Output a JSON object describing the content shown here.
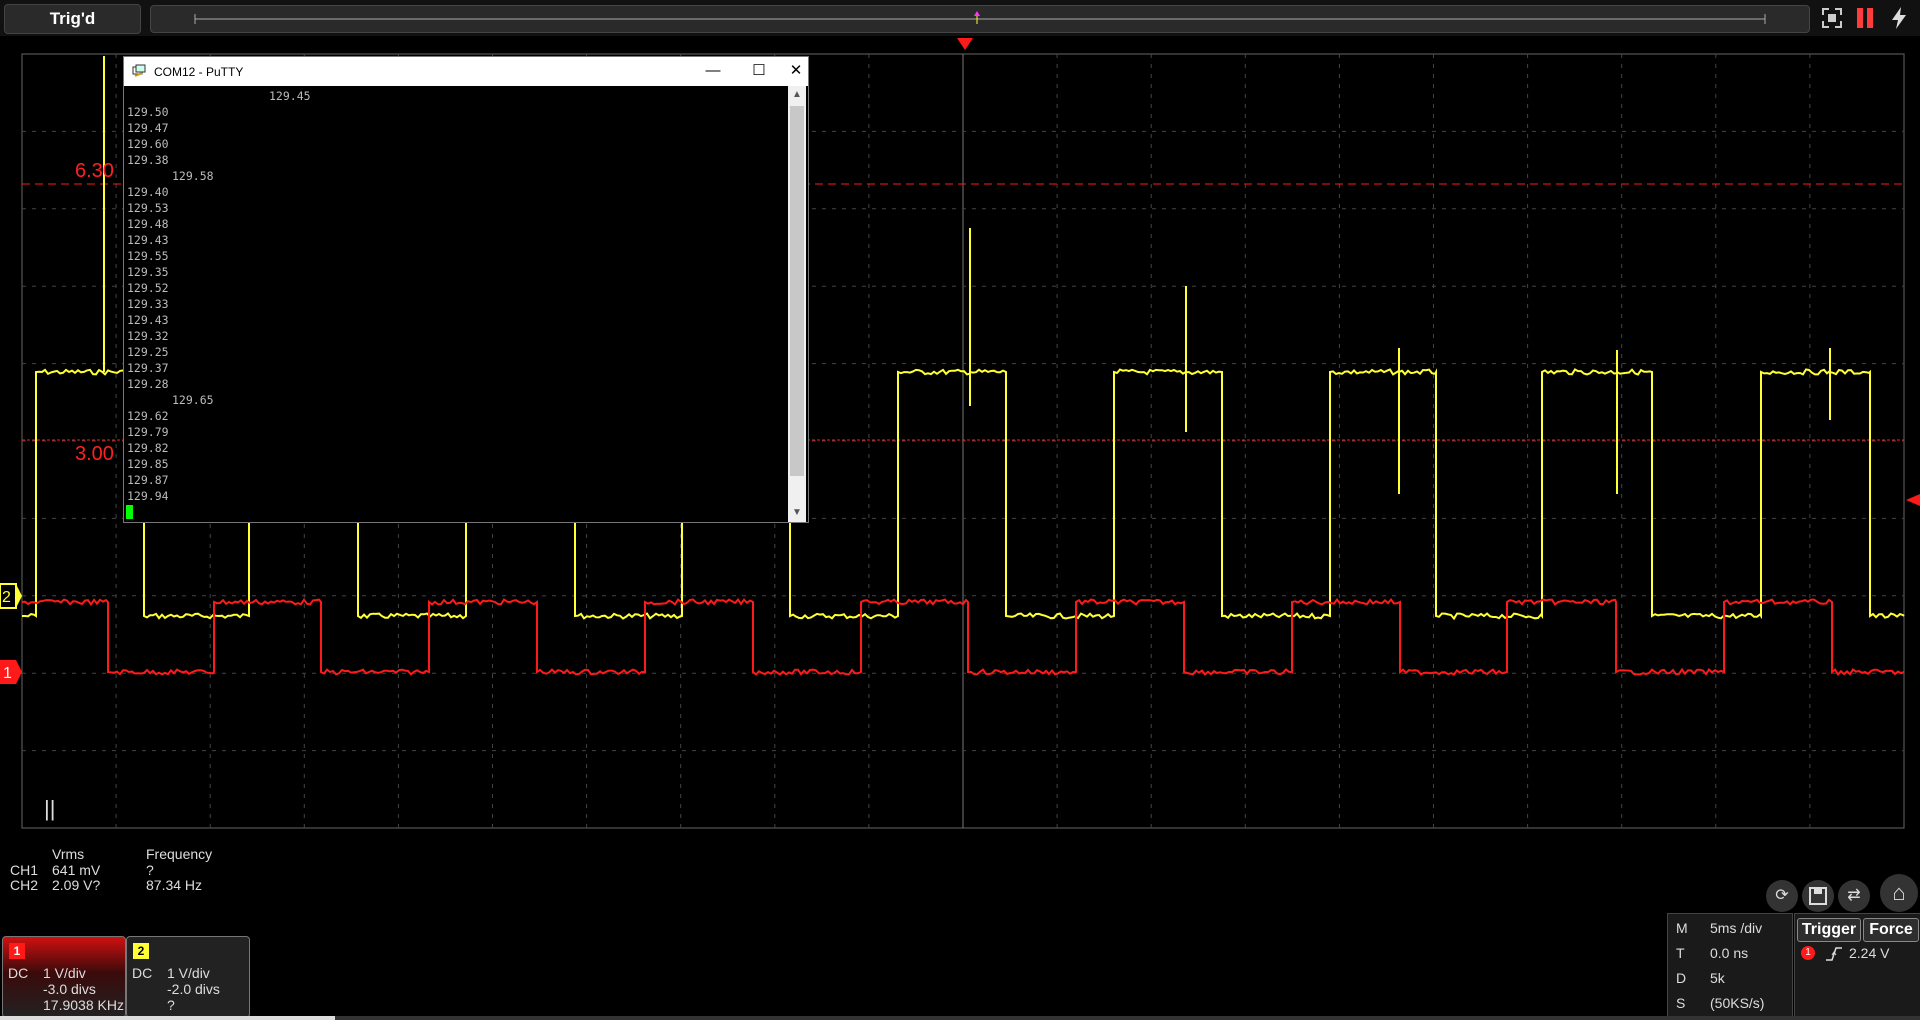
{
  "colors": {
    "ch1": "#ff1a1a",
    "ch2": "#ffff33",
    "grid": "#555555",
    "background": "#000000"
  },
  "top_bar": {
    "trigger_status": "Trig'd"
  },
  "top_icons": [
    "fullscreen-icon",
    "pause-icon",
    "power-icon"
  ],
  "levels": {
    "upper": "6.30",
    "lower": "3.00"
  },
  "markers": {
    "ch1": "1",
    "ch2": "2"
  },
  "putty": {
    "title": "COM12 - PuTTY",
    "lines": [
      {
        "text": "129.45",
        "indent": true
      },
      {
        "text": "129.50",
        "indent": false
      },
      {
        "text": "129.47",
        "indent": false
      },
      {
        "text": "129.60",
        "indent": false
      },
      {
        "text": "129.38",
        "indent": false
      },
      {
        "text": "129.58",
        "indent": true
      },
      {
        "text": "129.40",
        "indent": false
      },
      {
        "text": "129.53",
        "indent": false
      },
      {
        "text": "129.48",
        "indent": false
      },
      {
        "text": "129.43",
        "indent": false
      },
      {
        "text": "129.55",
        "indent": false
      },
      {
        "text": "129.35",
        "indent": false
      },
      {
        "text": "129.52",
        "indent": false
      },
      {
        "text": "129.33",
        "indent": false
      },
      {
        "text": "129.43",
        "indent": false
      },
      {
        "text": "129.32",
        "indent": false
      },
      {
        "text": "129.25",
        "indent": false
      },
      {
        "text": "129.37",
        "indent": false
      },
      {
        "text": "129.28",
        "indent": false
      },
      {
        "text": "129.65",
        "indent": true
      },
      {
        "text": "129.62",
        "indent": false
      },
      {
        "text": "129.79",
        "indent": false
      },
      {
        "text": "129.82",
        "indent": false
      },
      {
        "text": "129.85",
        "indent": false
      },
      {
        "text": "129.87",
        "indent": false
      },
      {
        "text": "129.94",
        "indent": false
      }
    ]
  },
  "measurements": {
    "headers": {
      "vrms": "Vrms",
      "frequency": "Frequency"
    },
    "rows": [
      {
        "channel": "CH1",
        "vrms": "641 mV",
        "frequency": "?"
      },
      {
        "channel": "CH2",
        "vrms": "2.09 V?",
        "frequency": "87.34 Hz"
      }
    ]
  },
  "channels": [
    {
      "num": "1",
      "coupling": "DC",
      "scale": "1 V/div",
      "offset": "-3.0 divs",
      "freq": "17.9038 KHz"
    },
    {
      "num": "2",
      "coupling": "DC",
      "scale": "1 V/div",
      "offset": "-2.0 divs",
      "freq": "?"
    }
  ],
  "timebase": {
    "rows": [
      {
        "key": "M",
        "value": "5ms /div"
      },
      {
        "key": "T",
        "value": "0.0 ns"
      },
      {
        "key": "D",
        "value": "5k"
      },
      {
        "key": "S",
        "value": "(50KS/s)"
      }
    ]
  },
  "trigger": {
    "trigger_label": "Trigger",
    "force_label": "Force",
    "channel": "1",
    "level": "2.24 V"
  },
  "run_indicator": "||"
}
